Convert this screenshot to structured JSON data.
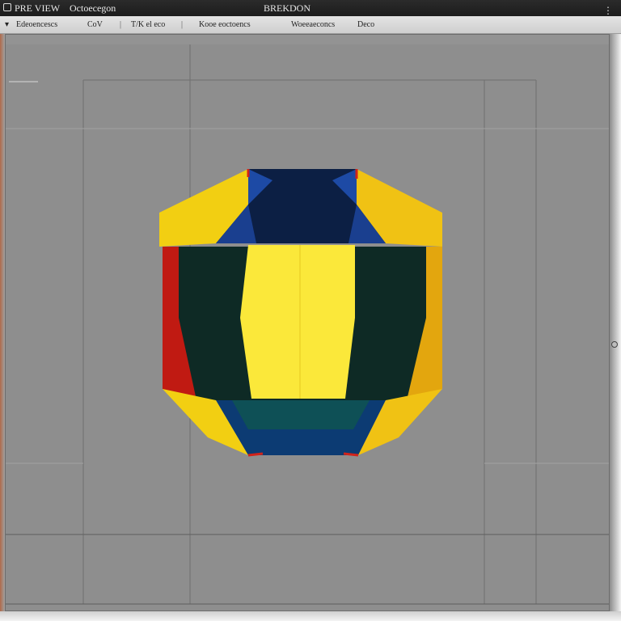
{
  "titlebar": {
    "left_label_1": "PRE VIEW",
    "left_label_2": "Octoecegon",
    "window_title": "BREKDON",
    "menu_icon": "kebab-menu-icon"
  },
  "menubar": {
    "caret": "▾",
    "item_1": "Edeoencescs",
    "item_2": "CoV",
    "item_3": "T/K  el  eco",
    "separator": "|",
    "item_4": "Kooe eoctoencs",
    "item_5": "Woeeaeconcs",
    "item_6": "Deco"
  },
  "viewport": {
    "object_name": "octagonal-prism",
    "colors": {
      "background": "#8e8e8e",
      "yellow": "#f2cf12",
      "bright_yellow": "#fbe83a",
      "dark_green": "#0e2a25",
      "navy": "#0c1f44",
      "blue": "#1d4aa5",
      "red": "#c01a12",
      "orange_yellow": "#e3a60e"
    }
  },
  "icons": {
    "app": "app-icon",
    "resize_handle": "resize-handle-icon"
  }
}
